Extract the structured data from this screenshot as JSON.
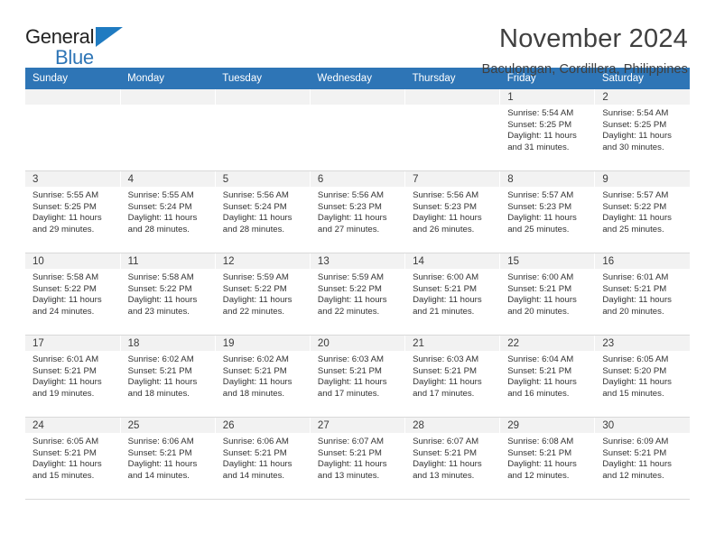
{
  "brand": {
    "name_part1": "General",
    "name_part2": "Blue",
    "mark": "triangle-logo-icon",
    "accent_color": "#2E75B6"
  },
  "header": {
    "month_title": "November 2024",
    "location": "Baculongan, Cordillera, Philippines"
  },
  "calendar": {
    "weekday_headers": [
      "Sunday",
      "Monday",
      "Tuesday",
      "Wednesday",
      "Thursday",
      "Friday",
      "Saturday"
    ],
    "header_bg": "#2E75B6",
    "daynum_bg": "#f2f2f2",
    "weeks": [
      [
        {
          "day": "",
          "lines": []
        },
        {
          "day": "",
          "lines": []
        },
        {
          "day": "",
          "lines": []
        },
        {
          "day": "",
          "lines": []
        },
        {
          "day": "",
          "lines": []
        },
        {
          "day": "1",
          "lines": [
            "Sunrise: 5:54 AM",
            "Sunset: 5:25 PM",
            "Daylight: 11 hours",
            "and 31 minutes."
          ]
        },
        {
          "day": "2",
          "lines": [
            "Sunrise: 5:54 AM",
            "Sunset: 5:25 PM",
            "Daylight: 11 hours",
            "and 30 minutes."
          ]
        }
      ],
      [
        {
          "day": "3",
          "lines": [
            "Sunrise: 5:55 AM",
            "Sunset: 5:25 PM",
            "Daylight: 11 hours",
            "and 29 minutes."
          ]
        },
        {
          "day": "4",
          "lines": [
            "Sunrise: 5:55 AM",
            "Sunset: 5:24 PM",
            "Daylight: 11 hours",
            "and 28 minutes."
          ]
        },
        {
          "day": "5",
          "lines": [
            "Sunrise: 5:56 AM",
            "Sunset: 5:24 PM",
            "Daylight: 11 hours",
            "and 28 minutes."
          ]
        },
        {
          "day": "6",
          "lines": [
            "Sunrise: 5:56 AM",
            "Sunset: 5:23 PM",
            "Daylight: 11 hours",
            "and 27 minutes."
          ]
        },
        {
          "day": "7",
          "lines": [
            "Sunrise: 5:56 AM",
            "Sunset: 5:23 PM",
            "Daylight: 11 hours",
            "and 26 minutes."
          ]
        },
        {
          "day": "8",
          "lines": [
            "Sunrise: 5:57 AM",
            "Sunset: 5:23 PM",
            "Daylight: 11 hours",
            "and 25 minutes."
          ]
        },
        {
          "day": "9",
          "lines": [
            "Sunrise: 5:57 AM",
            "Sunset: 5:22 PM",
            "Daylight: 11 hours",
            "and 25 minutes."
          ]
        }
      ],
      [
        {
          "day": "10",
          "lines": [
            "Sunrise: 5:58 AM",
            "Sunset: 5:22 PM",
            "Daylight: 11 hours",
            "and 24 minutes."
          ]
        },
        {
          "day": "11",
          "lines": [
            "Sunrise: 5:58 AM",
            "Sunset: 5:22 PM",
            "Daylight: 11 hours",
            "and 23 minutes."
          ]
        },
        {
          "day": "12",
          "lines": [
            "Sunrise: 5:59 AM",
            "Sunset: 5:22 PM",
            "Daylight: 11 hours",
            "and 22 minutes."
          ]
        },
        {
          "day": "13",
          "lines": [
            "Sunrise: 5:59 AM",
            "Sunset: 5:22 PM",
            "Daylight: 11 hours",
            "and 22 minutes."
          ]
        },
        {
          "day": "14",
          "lines": [
            "Sunrise: 6:00 AM",
            "Sunset: 5:21 PM",
            "Daylight: 11 hours",
            "and 21 minutes."
          ]
        },
        {
          "day": "15",
          "lines": [
            "Sunrise: 6:00 AM",
            "Sunset: 5:21 PM",
            "Daylight: 11 hours",
            "and 20 minutes."
          ]
        },
        {
          "day": "16",
          "lines": [
            "Sunrise: 6:01 AM",
            "Sunset: 5:21 PM",
            "Daylight: 11 hours",
            "and 20 minutes."
          ]
        }
      ],
      [
        {
          "day": "17",
          "lines": [
            "Sunrise: 6:01 AM",
            "Sunset: 5:21 PM",
            "Daylight: 11 hours",
            "and 19 minutes."
          ]
        },
        {
          "day": "18",
          "lines": [
            "Sunrise: 6:02 AM",
            "Sunset: 5:21 PM",
            "Daylight: 11 hours",
            "and 18 minutes."
          ]
        },
        {
          "day": "19",
          "lines": [
            "Sunrise: 6:02 AM",
            "Sunset: 5:21 PM",
            "Daylight: 11 hours",
            "and 18 minutes."
          ]
        },
        {
          "day": "20",
          "lines": [
            "Sunrise: 6:03 AM",
            "Sunset: 5:21 PM",
            "Daylight: 11 hours",
            "and 17 minutes."
          ]
        },
        {
          "day": "21",
          "lines": [
            "Sunrise: 6:03 AM",
            "Sunset: 5:21 PM",
            "Daylight: 11 hours",
            "and 17 minutes."
          ]
        },
        {
          "day": "22",
          "lines": [
            "Sunrise: 6:04 AM",
            "Sunset: 5:21 PM",
            "Daylight: 11 hours",
            "and 16 minutes."
          ]
        },
        {
          "day": "23",
          "lines": [
            "Sunrise: 6:05 AM",
            "Sunset: 5:20 PM",
            "Daylight: 11 hours",
            "and 15 minutes."
          ]
        }
      ],
      [
        {
          "day": "24",
          "lines": [
            "Sunrise: 6:05 AM",
            "Sunset: 5:21 PM",
            "Daylight: 11 hours",
            "and 15 minutes."
          ]
        },
        {
          "day": "25",
          "lines": [
            "Sunrise: 6:06 AM",
            "Sunset: 5:21 PM",
            "Daylight: 11 hours",
            "and 14 minutes."
          ]
        },
        {
          "day": "26",
          "lines": [
            "Sunrise: 6:06 AM",
            "Sunset: 5:21 PM",
            "Daylight: 11 hours",
            "and 14 minutes."
          ]
        },
        {
          "day": "27",
          "lines": [
            "Sunrise: 6:07 AM",
            "Sunset: 5:21 PM",
            "Daylight: 11 hours",
            "and 13 minutes."
          ]
        },
        {
          "day": "28",
          "lines": [
            "Sunrise: 6:07 AM",
            "Sunset: 5:21 PM",
            "Daylight: 11 hours",
            "and 13 minutes."
          ]
        },
        {
          "day": "29",
          "lines": [
            "Sunrise: 6:08 AM",
            "Sunset: 5:21 PM",
            "Daylight: 11 hours",
            "and 12 minutes."
          ]
        },
        {
          "day": "30",
          "lines": [
            "Sunrise: 6:09 AM",
            "Sunset: 5:21 PM",
            "Daylight: 11 hours",
            "and 12 minutes."
          ]
        }
      ]
    ]
  }
}
